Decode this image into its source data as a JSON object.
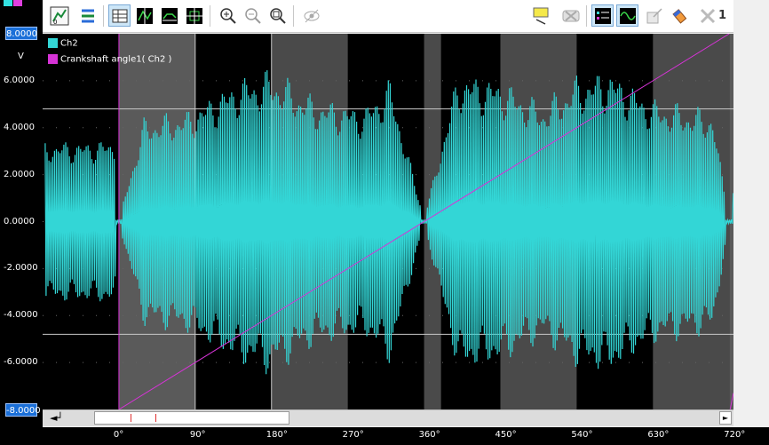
{
  "toolbar": {
    "cursor_number": "1",
    "icons": [
      "scale-icon",
      "channel-layout-icon",
      "table-view-icon",
      "cursor-mode-icon",
      "trace-icon",
      "fit-icon",
      "zoom-in-icon",
      "zoom-out-icon",
      "zoom-fit-icon",
      "visibility-icon",
      "comment-icon",
      "cancel-icon",
      "channel-list-icon",
      "waveform-icon",
      "export-icon",
      "eraser-icon",
      "close-icon"
    ]
  },
  "colors": {
    "ch2": "#33d6d6",
    "angle": "#d633d6",
    "plot_bg": "#000000",
    "band": "#4a4a4a",
    "band_light": "#5a5a5a",
    "cursor": "#c8c8c8"
  },
  "chart_data": {
    "type": "line",
    "title": "",
    "xlabel": "",
    "ylabel": "V",
    "x_unit": "°",
    "xlim": [
      -90,
      725
    ],
    "ylim": [
      -8,
      8
    ],
    "x_ticks": [
      "0°",
      "90°",
      "180°",
      "270°",
      "360°",
      "450°",
      "540°",
      "630°",
      "720°"
    ],
    "y_ticks": [
      "8.0000",
      "6.0000",
      "4.0000",
      "2.0000",
      "0.0000",
      "-2.0000",
      "-4.0000",
      "-6.0000",
      "-8.0000"
    ],
    "grid": true,
    "legend_position": "top-left",
    "series": [
      {
        "name": "Ch2",
        "approx_envelope": {
          "x": [
            -38,
            -5,
            0,
            30,
            80,
            140,
            180,
            230,
            290,
            320,
            360,
            400,
            450,
            500,
            540,
            580,
            630,
            700,
            720,
            735
          ],
          "amp": [
            3.5,
            3.6,
            0.1,
            4.5,
            4.8,
            6.2,
            6.6,
            5.4,
            5.0,
            6.2,
            0.1,
            6.5,
            6.2,
            5.1,
            6.3,
            6.6,
            5.3,
            4.8,
            0.1,
            4.0
          ]
        }
      },
      {
        "name": "Crankshaft angle1( Ch2 )",
        "x": [
          0,
          720
        ],
        "y": [
          -8,
          8
        ]
      }
    ],
    "cursor_lines_y": [
      4.8,
      -4.8
    ],
    "cursor_lines_x": [
      90,
      180
    ]
  },
  "ylabel_text": "V",
  "legend": {
    "ch2": "Ch2",
    "angle": "Crankshaft angle1( Ch2 )"
  },
  "ybox_top": "8.0000",
  "ybox_bottom": "-8.0000",
  "scroll": {
    "arrow_right": "►"
  }
}
